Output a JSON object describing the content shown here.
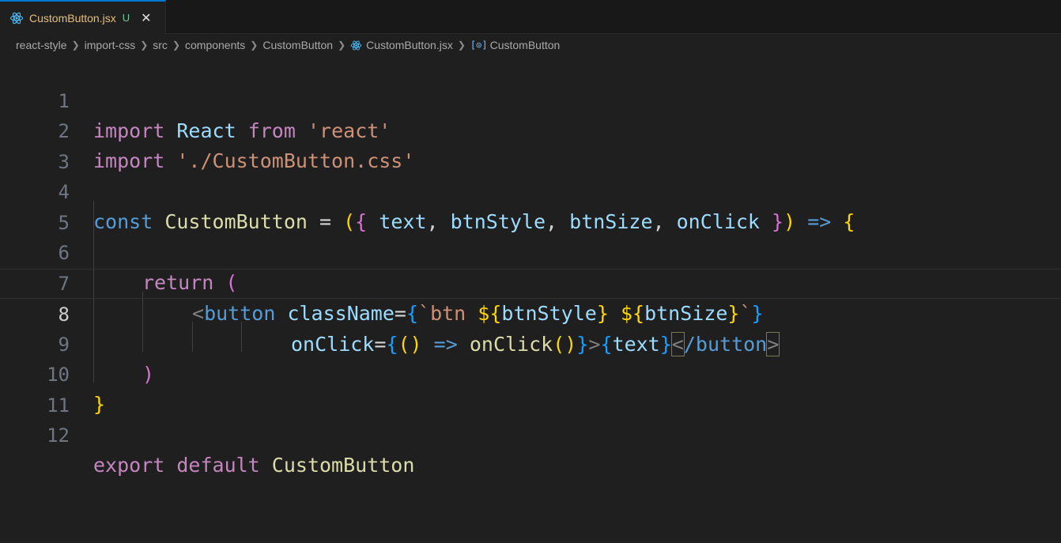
{
  "tab": {
    "filename": "CustomButton.jsx",
    "status": "U",
    "close": "✕"
  },
  "breadcrumb": [
    "react-style",
    "import-css",
    "src",
    "components",
    "CustomButton",
    "CustomButton.jsx",
    "CustomButton"
  ],
  "line_numbers": [
    "1",
    "2",
    "3",
    "4",
    "5",
    "6",
    "7",
    "8",
    "9",
    "10",
    "11",
    "12"
  ],
  "code": {
    "l1": [
      "import",
      " ",
      "React",
      " ",
      "from",
      " ",
      "'react'"
    ],
    "l2": [
      "import",
      " ",
      "'./CustomButton.css'"
    ],
    "l4": [
      "const",
      " ",
      "CustomButton",
      " = ",
      "(",
      "{",
      " ",
      "text",
      ", ",
      "btnStyle",
      ", ",
      "btnSize",
      ", ",
      "onClick",
      " ",
      "}",
      ")",
      " ",
      "=>",
      " ",
      "{"
    ],
    "l6": [
      "return",
      " ",
      "("
    ],
    "l7": [
      "<",
      "button",
      " ",
      "className",
      "=",
      "{",
      "`btn ",
      "${",
      "btnStyle",
      "}",
      " ",
      "${",
      "btnSize",
      "}",
      "`",
      "}"
    ],
    "l8": [
      "onClick",
      "=",
      "{",
      "(",
      ")",
      " ",
      "=>",
      " ",
      "onClick",
      "(",
      ")",
      "}",
      ">",
      "{",
      "text",
      "}",
      "<",
      "/button",
      ">"
    ],
    "l9": [
      ")"
    ],
    "l10": [
      "}"
    ],
    "l12": [
      "export",
      " ",
      "default",
      " ",
      "CustomButton"
    ]
  },
  "colors": {
    "background": "#1f1f1f",
    "tab_accent": "#0078d4",
    "keyword_control": "#c586c0",
    "keyword": "#569cd6",
    "string": "#ce9178",
    "variable": "#9cdcfe",
    "function": "#dcdcaa"
  },
  "icons": {
    "tab_file": "react-icon",
    "breadcrumb_file": "react-icon",
    "breadcrumb_symbol": "symbol-constant-icon"
  }
}
